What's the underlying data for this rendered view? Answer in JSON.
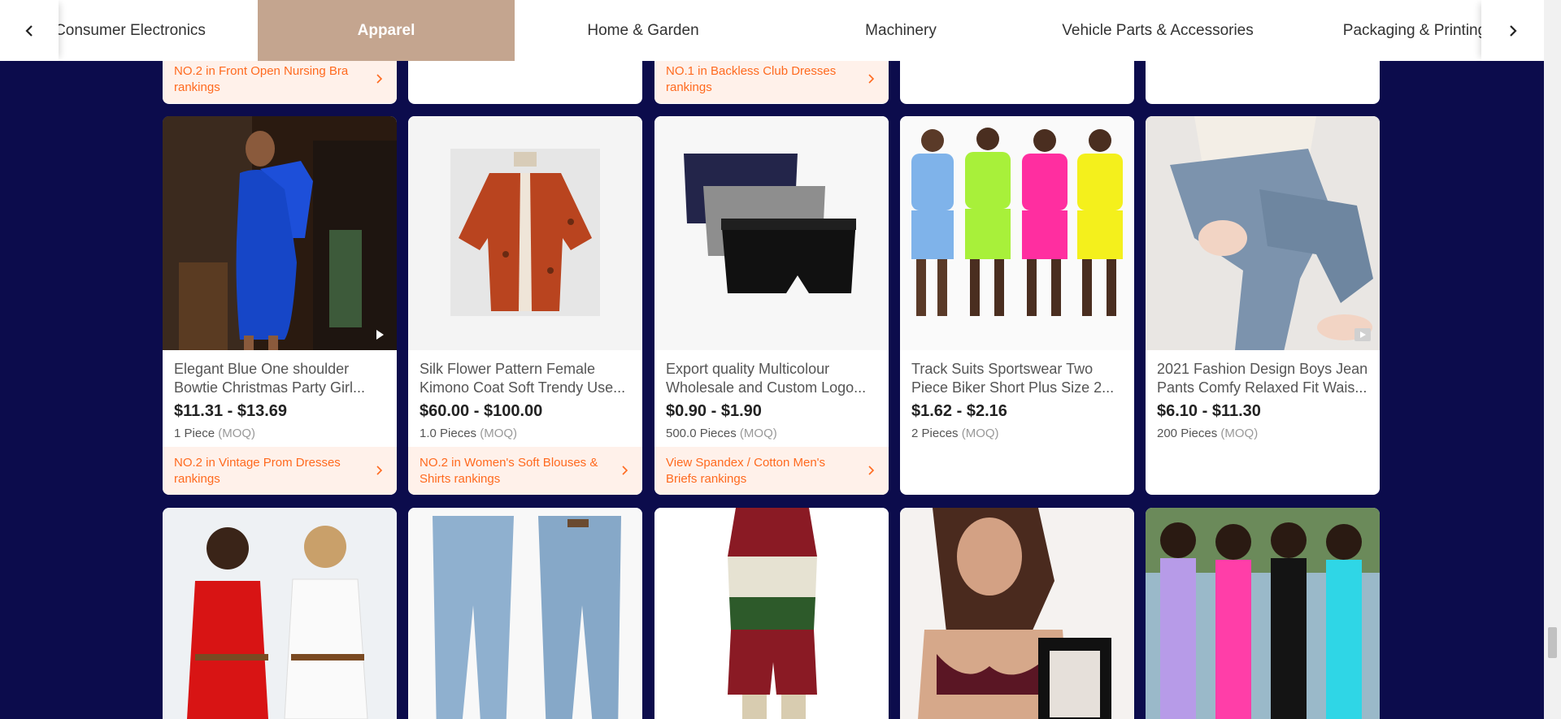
{
  "categories": [
    "Consumer Electronics",
    "Apparel",
    "Home & Garden",
    "Machinery",
    "Vehicle Parts & Accessories",
    "Packaging & Printing"
  ],
  "active_category": "Apparel",
  "icons": {
    "prev": "chevron-left-icon",
    "next": "chevron-right-icon",
    "rank_arrow": "chevron-right-icon",
    "video": "play-icon"
  },
  "colors": {
    "background": "#0c0c4c",
    "active_tab": "#c4a58f",
    "rank_text": "#ff6a1f",
    "rank_bg": "#fff1ea"
  },
  "top_rankings": [
    "NO.2 in Front Open Nursing Bra rankings",
    "",
    "NO.1 in Backless Club Dresses rankings",
    "",
    ""
  ],
  "moq_label": "(MOQ)",
  "products": [
    {
      "title": "Elegant Blue One shoulder Bowtie Christmas Party Girl...",
      "price": "$11.31 - $13.69",
      "qty": "1 Piece",
      "ranking": "NO.2 in Vintage Prom Dresses rankings",
      "video": true
    },
    {
      "title": "Silk Flower Pattern Female Kimono Coat Soft Trendy Use...",
      "price": "$60.00 - $100.00",
      "qty": "1.0 Pieces",
      "ranking": "NO.2 in Women's Soft Blouses & Shirts rankings",
      "video": false
    },
    {
      "title": "Export quality Multicolour Wholesale and Custom Logo...",
      "price": "$0.90 - $1.90",
      "qty": "500.0 Pieces",
      "ranking": "View Spandex / Cotton Men's Briefs rankings",
      "video": false
    },
    {
      "title": "Track Suits Sportswear Two Piece Biker Short Plus Size 2...",
      "price": "$1.62 - $2.16",
      "qty": "2 Pieces",
      "ranking": "",
      "video": false
    },
    {
      "title": "2021 Fashion Design Boys Jean Pants Comfy Relaxed Fit Wais...",
      "price": "$6.10 - $11.30",
      "qty": "200 Pieces",
      "ranking": "",
      "video": true
    }
  ]
}
